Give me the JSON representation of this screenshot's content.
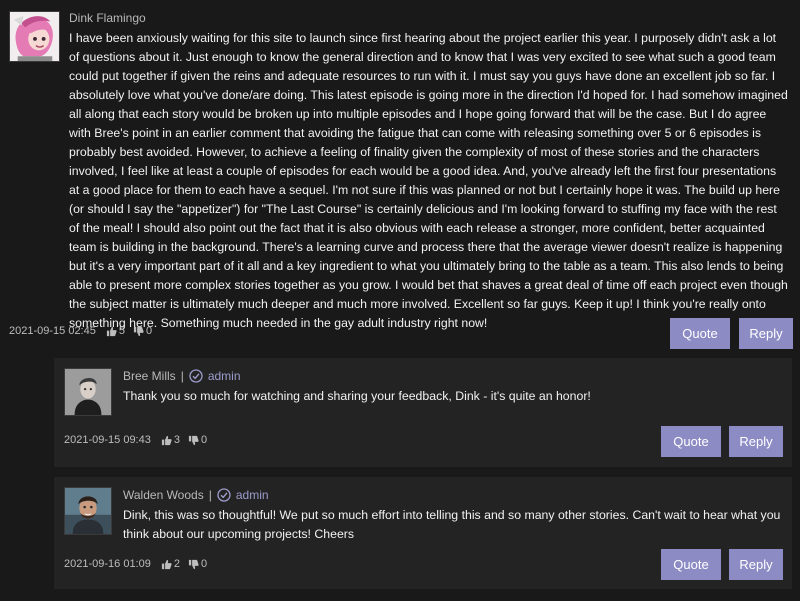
{
  "comments": [
    {
      "author": "Dink Flamingo",
      "avatar_icon": "cartoon-avatar-pink-hair-icon",
      "body": "I have been anxiously waiting for this site to launch since first hearing about the project earlier this year. I purposely didn't ask a lot of questions about it. Just enough to know the general direction and to know that I was very excited to see what such a good team could put together if given the reins and adequate resources to run with it. I must say you guys have done an excellent job so far. I absolutely love what you've done/are doing. This latest episode is going more in the direction I'd hoped for. I had somehow imagined all along that each story would be broken up into multiple episodes and I hope going forward that will be the case. But I do agree with Bree's point in an earlier comment that avoiding the fatigue that can come with releasing something over 5 or 6 episodes is probably best avoided. However, to achieve a feeling of finality given the complexity of most of these stories and the characters involved, I feel like at least a couple of episodes for each would be a good idea. And, you've already left the first four presentations at a good place for them to each have a sequel. I'm not sure if this was planned or not but I certainly hope it was. The build up here (or should I say the \"appetizer\") for \"The Last Course\" is certainly delicious and I'm looking forward to stuffing my face with the rest of the meal! I should also point out the fact that it is also obvious with each release a stronger, more confident, better acquainted team is building in the background. There's a learning curve and process there that the average viewer doesn't realize is happening but it's a very important part of it all and a key ingredient to what you ultimately bring to the table as a team. This also lends to being able to present more complex stories together as you grow. I would bet that shaves a great deal of time off each project even though the subject matter is ultimately much deeper and much more involved. Excellent so far guys. Keep it up! I think you're really onto something here. Something much needed in the gay adult industry right now!",
      "date": "2021-09-15 02:45",
      "likes": "5",
      "dislikes": "0",
      "quote_label": "Quote",
      "reply_label": "Reply"
    }
  ],
  "replies": [
    {
      "author": "Bree Mills",
      "separator": "|",
      "role": "admin",
      "avatar_icon": "user-photo-avatar-icon",
      "body": "Thank you so much for watching and sharing your feedback, Dink - it's quite an honor!",
      "date": "2021-09-15 09:43",
      "likes": "3",
      "dislikes": "0",
      "quote_label": "Quote",
      "reply_label": "Reply"
    },
    {
      "author": "Walden Woods",
      "separator": "|",
      "role": "admin",
      "avatar_icon": "user-photo-avatar-icon",
      "body": "Dink, this was so thoughtful! We put so much effort into telling this and so many other stories. Can't wait to hear what you think about our upcoming projects! Cheers",
      "date": "2021-09-16 01:09",
      "likes": "2",
      "dislikes": "0",
      "quote_label": "Quote",
      "reply_label": "Reply"
    }
  ],
  "colors": {
    "background": "#191919",
    "reply_background": "#232323",
    "button": "#8d8bc4",
    "role_text": "#9c9ccc"
  }
}
